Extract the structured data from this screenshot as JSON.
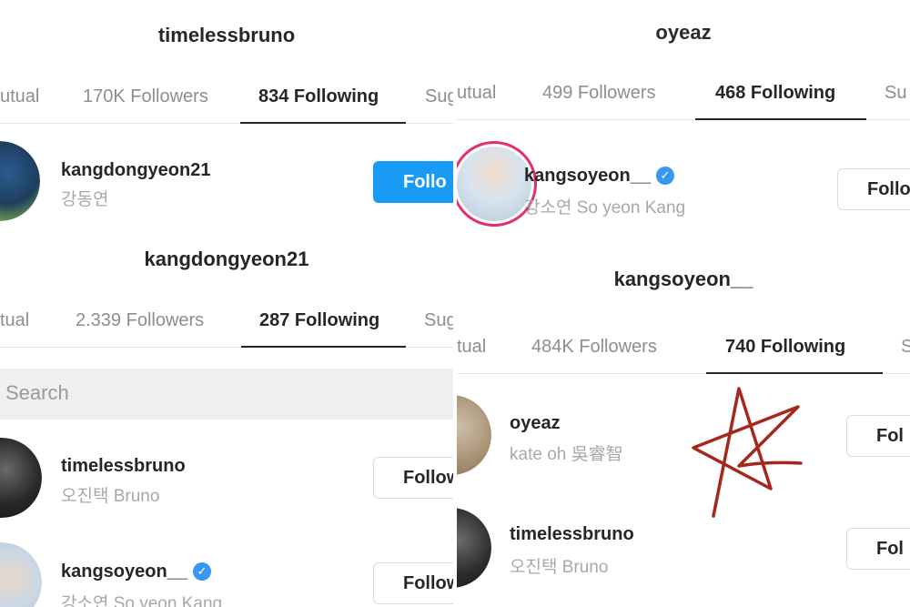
{
  "panels": {
    "top_left": {
      "title": "timelessbruno",
      "tabs": [
        "utual",
        "170K Followers",
        "834 Following",
        "Sug"
      ],
      "rows": [
        {
          "username": "kangdongyeon21",
          "fullname": "강동연",
          "button": "Follo",
          "verified": false
        }
      ]
    },
    "bottom_left": {
      "title": "kangdongyeon21",
      "tabs": [
        "tual",
        "2.339 Followers",
        "287 Following",
        "Sug"
      ],
      "search_placeholder": "Search",
      "rows": [
        {
          "username": "timelessbruno",
          "fullname": "오진택 Bruno",
          "button": "Follow",
          "verified": false
        },
        {
          "username": "kangsoyeon__",
          "fullname": "강소연 So yeon Kang",
          "button": "Follow",
          "verified": true
        }
      ]
    },
    "top_right": {
      "title": "oyeaz",
      "tabs": [
        "utual",
        "499 Followers",
        "468 Following",
        "Su"
      ],
      "rows": [
        {
          "username": "kangsoyeon__",
          "fullname": "강소연 So yeon Kang",
          "button": "Follo",
          "verified": true
        }
      ]
    },
    "bottom_right": {
      "title": "kangsoyeon__",
      "tabs": [
        "tual",
        "484K Followers",
        "740 Following",
        "S"
      ],
      "rows": [
        {
          "username": "oyeaz",
          "fullname": "kate oh 吳睿智",
          "button": "Fol",
          "verified": false
        },
        {
          "username": "timelessbruno",
          "fullname": "오진택 Bruno",
          "button": "Fol",
          "verified": false
        }
      ]
    }
  },
  "icons": {
    "verified": "verified-badge-icon",
    "annotation": "star-scribble-icon"
  },
  "colors": {
    "accent": "#1a9af7",
    "verified": "#3897f0",
    "story_ring": "#e1306c",
    "scribble": "#a5281c"
  }
}
